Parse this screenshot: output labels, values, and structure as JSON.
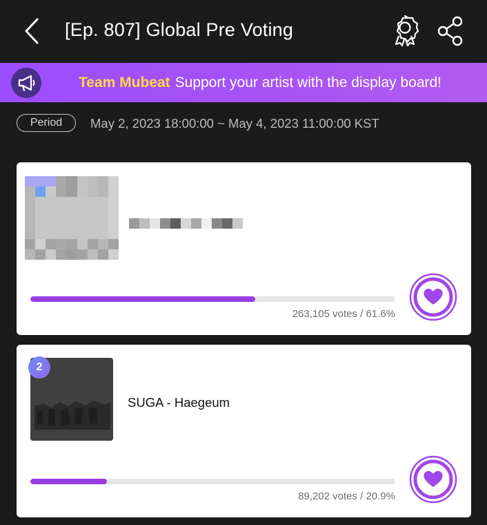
{
  "header": {
    "title": "[Ep. 807] Global Pre Voting",
    "back_icon": "chevron-left-icon",
    "award_icon": "award-ribbon-icon",
    "share_icon": "share-icon"
  },
  "banner": {
    "brand": "Team Mubeat",
    "message": "Support your artist with the display board!",
    "icon": "megaphone-icon"
  },
  "period": {
    "label": "Period",
    "range": "May 2, 2023 18:00:00 ~ May 4, 2023 11:00:00 KST"
  },
  "candidates": [
    {
      "rank": "",
      "name": "",
      "votes": "263,105 votes / 61.6%",
      "percent": 61.6
    },
    {
      "rank": "2",
      "name": "SUGA - Haegeum",
      "votes": "89,202 votes / 20.9%",
      "percent": 20.9
    }
  ],
  "colors": {
    "accent": "#9a3de3",
    "brand_yellow": "#ffd84a",
    "background": "#1b1b1b"
  }
}
